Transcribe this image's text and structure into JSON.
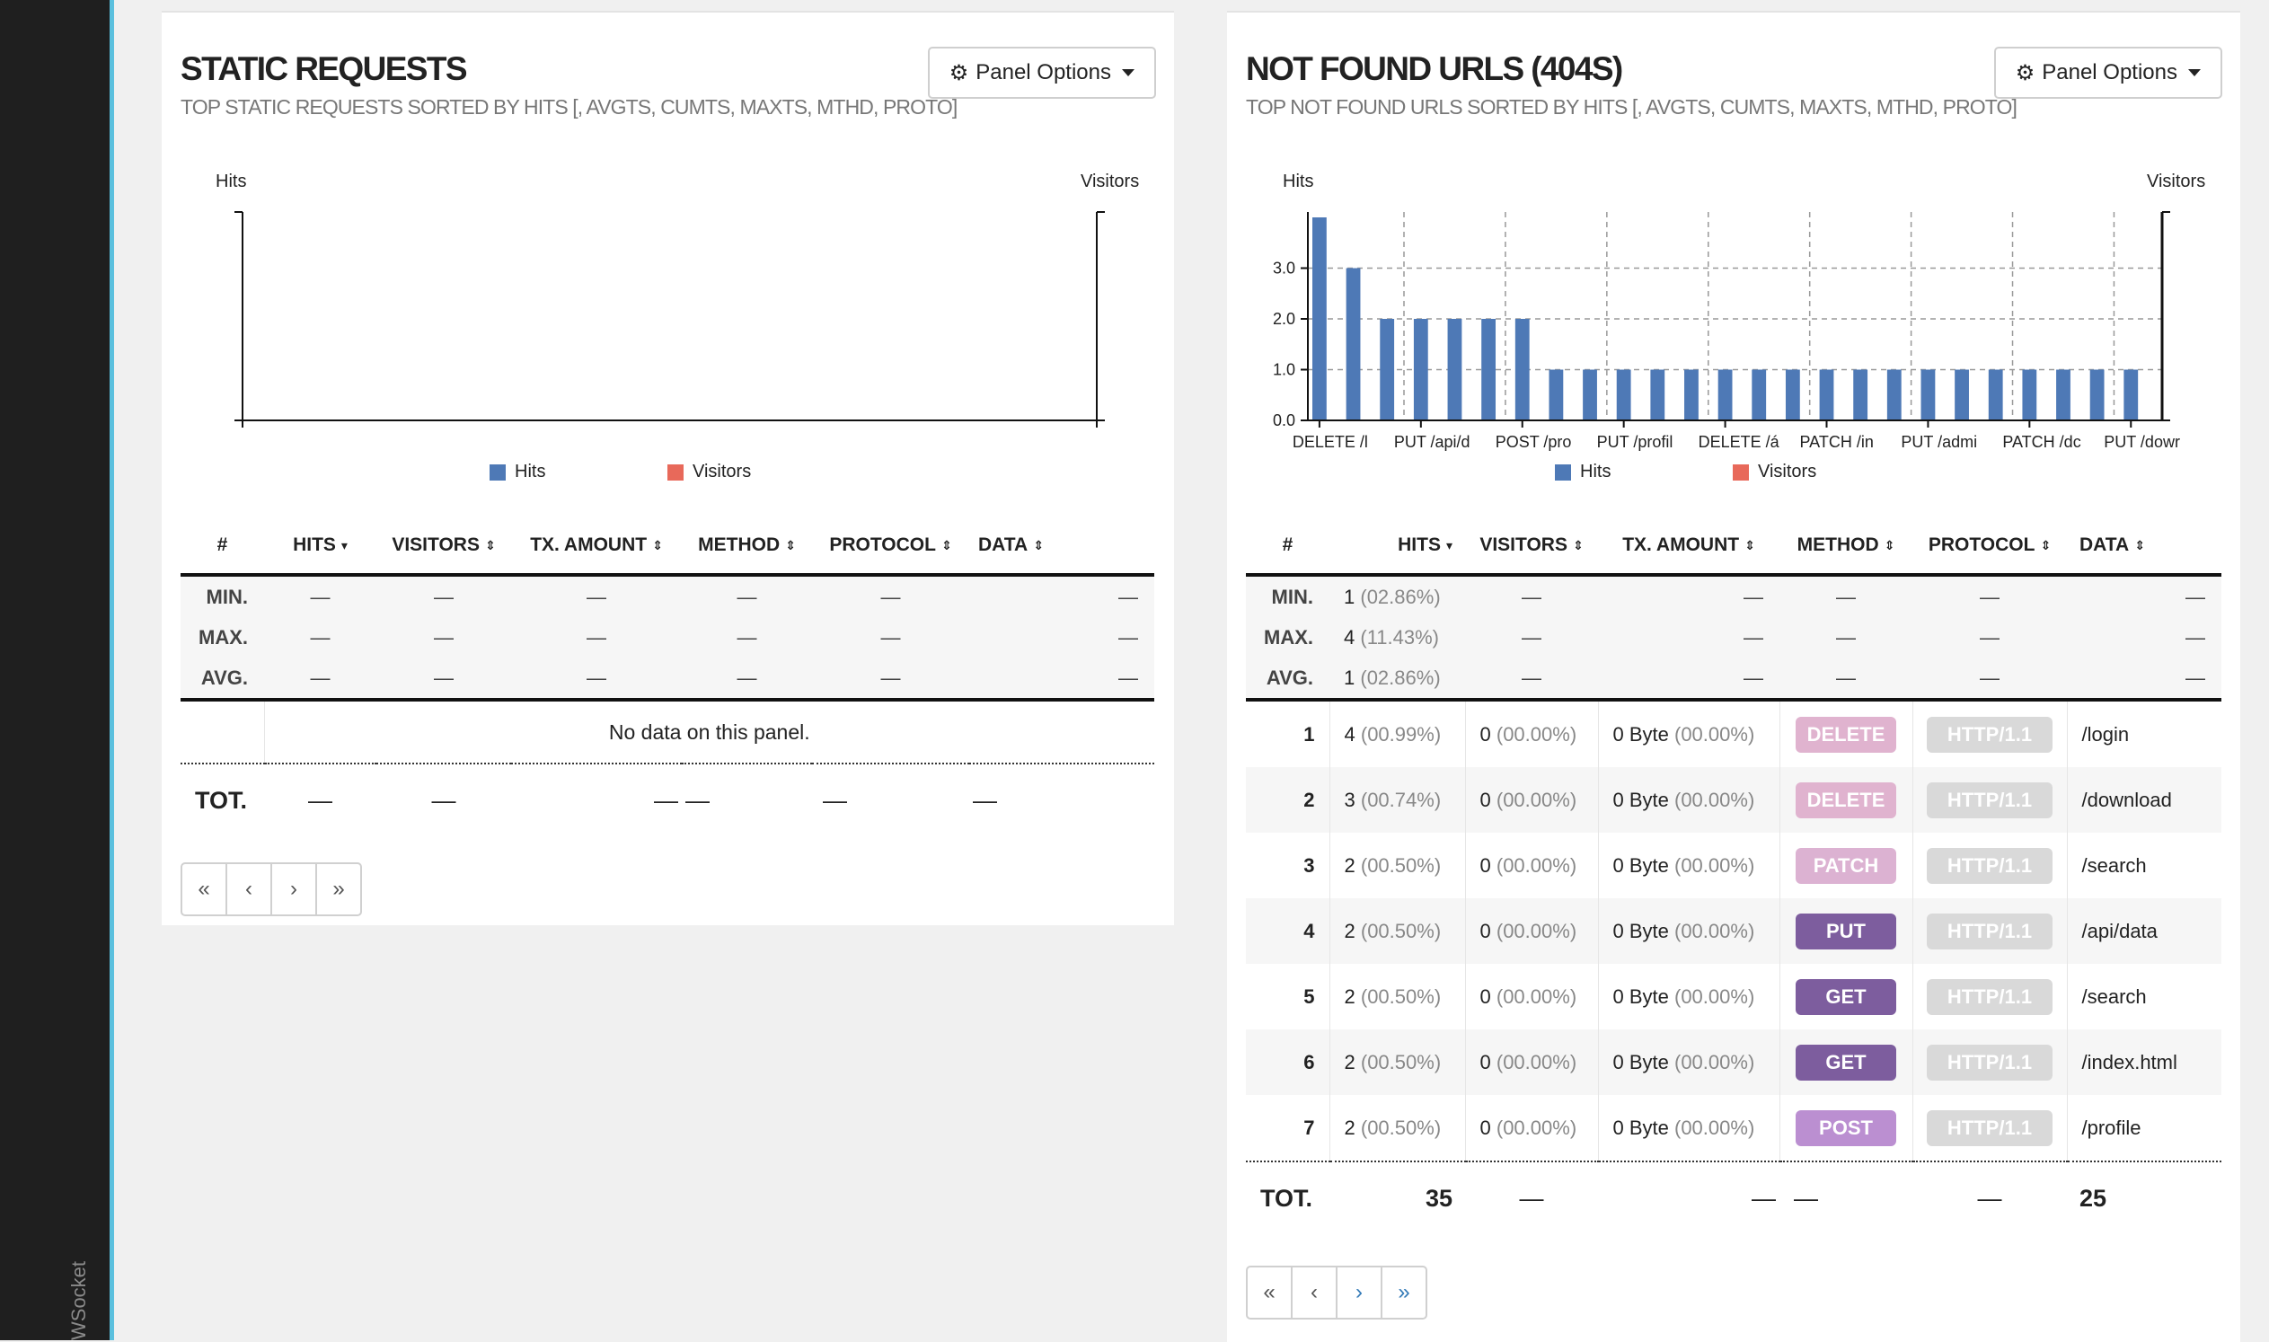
{
  "sidebar": {
    "websocket_label": "WSocket"
  },
  "static_panel": {
    "title": "STATIC REQUESTS",
    "subtitle": "TOP STATIC REQUESTS SORTED BY HITS [, AVGTS, CUMTS, MAXTS, MTHD, PROTO]",
    "options_label": "Panel Options",
    "chart": {
      "left_axis": "Hits",
      "right_axis": "Visitors"
    },
    "legend": {
      "hits": "Hits",
      "visitors": "Visitors"
    },
    "columns": [
      "#",
      "HITS",
      "VISITORS",
      "TX. AMOUNT",
      "METHOD",
      "PROTOCOL",
      "DATA"
    ],
    "summary": {
      "min": "MIN.",
      "max": "MAX.",
      "avg": "AVG.",
      "dash": "—"
    },
    "no_data": "No data on this panel.",
    "total": {
      "label": "TOT.",
      "dash": "—"
    }
  },
  "notfound_panel": {
    "title": "NOT FOUND URLS (404S)",
    "subtitle": "TOP NOT FOUND URLS SORTED BY HITS [, AVGTS, CUMTS, MAXTS, MTHD, PROTO]",
    "options_label": "Panel Options",
    "legend": {
      "hits": "Hits",
      "visitors": "Visitors"
    },
    "columns": [
      "#",
      "HITS",
      "VISITORS",
      "TX. AMOUNT",
      "METHOD",
      "PROTOCOL",
      "DATA"
    ],
    "summary": {
      "min_label": "MIN.",
      "max_label": "MAX.",
      "avg_label": "AVG.",
      "min_hits": "1",
      "min_pct": "(02.86%)",
      "max_hits": "4",
      "max_pct": "(11.43%)",
      "avg_hits": "1",
      "avg_pct": "(02.86%)",
      "dash": "—"
    },
    "rows": [
      {
        "idx": "1",
        "hits": "4",
        "hits_pct": "(00.99%)",
        "visitors": "0",
        "visitors_pct": "(00.00%)",
        "tx": "0 Byte",
        "tx_pct": "(00.00%)",
        "method": "DELETE",
        "protocol": "HTTP/1.1",
        "data": "/login"
      },
      {
        "idx": "2",
        "hits": "3",
        "hits_pct": "(00.74%)",
        "visitors": "0",
        "visitors_pct": "(00.00%)",
        "tx": "0 Byte",
        "tx_pct": "(00.00%)",
        "method": "DELETE",
        "protocol": "HTTP/1.1",
        "data": "/download"
      },
      {
        "idx": "3",
        "hits": "2",
        "hits_pct": "(00.50%)",
        "visitors": "0",
        "visitors_pct": "(00.00%)",
        "tx": "0 Byte",
        "tx_pct": "(00.00%)",
        "method": "PATCH",
        "protocol": "HTTP/1.1",
        "data": "/search"
      },
      {
        "idx": "4",
        "hits": "2",
        "hits_pct": "(00.50%)",
        "visitors": "0",
        "visitors_pct": "(00.00%)",
        "tx": "0 Byte",
        "tx_pct": "(00.00%)",
        "method": "PUT",
        "protocol": "HTTP/1.1",
        "data": "/api/data"
      },
      {
        "idx": "5",
        "hits": "2",
        "hits_pct": "(00.50%)",
        "visitors": "0",
        "visitors_pct": "(00.00%)",
        "tx": "0 Byte",
        "tx_pct": "(00.00%)",
        "method": "GET",
        "protocol": "HTTP/1.1",
        "data": "/search"
      },
      {
        "idx": "6",
        "hits": "2",
        "hits_pct": "(00.50%)",
        "visitors": "0",
        "visitors_pct": "(00.00%)",
        "tx": "0 Byte",
        "tx_pct": "(00.00%)",
        "method": "GET",
        "protocol": "HTTP/1.1",
        "data": "/index.html"
      },
      {
        "idx": "7",
        "hits": "2",
        "hits_pct": "(00.50%)",
        "visitors": "0",
        "visitors_pct": "(00.00%)",
        "tx": "0 Byte",
        "tx_pct": "(00.00%)",
        "method": "POST",
        "protocol": "HTTP/1.1",
        "data": "/profile"
      }
    ],
    "total": {
      "label": "TOT.",
      "hits": "35",
      "dash": "—",
      "data": "25"
    }
  },
  "pager": {
    "first": "«",
    "prev": "‹",
    "next": "›",
    "last": "»"
  },
  "colors": {
    "hits": "#4e79b6",
    "visitors": "#e8695a",
    "DELETE": "#e0b3cf",
    "PATCH": "#dcb2d2",
    "PUT": "#7d5d9e",
    "GET": "#7d5d9e",
    "POST": "#bb8fd1",
    "protocol": "#d9d9d9"
  },
  "chart_data": [
    {
      "type": "bar",
      "title": "",
      "ylabel_left": "Hits",
      "ylabel_right": "Visitors",
      "categories": [],
      "series": [],
      "legend": [
        "Hits",
        "Visitors"
      ]
    },
    {
      "type": "bar",
      "title": "",
      "ylabel_left": "Hits",
      "ylabel_right": "Visitors",
      "ylim": [
        0,
        4
      ],
      "yticks": [
        "0.0",
        "1.0",
        "2.0",
        "3.0"
      ],
      "x_tick_labels": [
        "DELETE /l",
        "PUT /api/d",
        "POST /pro",
        "PUT /profil",
        "DELETE /á",
        "PATCH /in",
        "PUT /admi",
        "PATCH /dc",
        "PUT /dowr"
      ],
      "series": [
        {
          "name": "Hits",
          "values": [
            4,
            3,
            2,
            2,
            2,
            2,
            2,
            1,
            1,
            1,
            1,
            1,
            1,
            1,
            1,
            1,
            1,
            1,
            1,
            1,
            1,
            1,
            1,
            1,
            1
          ]
        },
        {
          "name": "Visitors",
          "values": [
            0,
            0,
            0,
            0,
            0,
            0,
            0,
            0,
            0,
            0,
            0,
            0,
            0,
            0,
            0,
            0,
            0,
            0,
            0,
            0,
            0,
            0,
            0,
            0,
            0
          ]
        }
      ],
      "legend": [
        "Hits",
        "Visitors"
      ]
    }
  ]
}
